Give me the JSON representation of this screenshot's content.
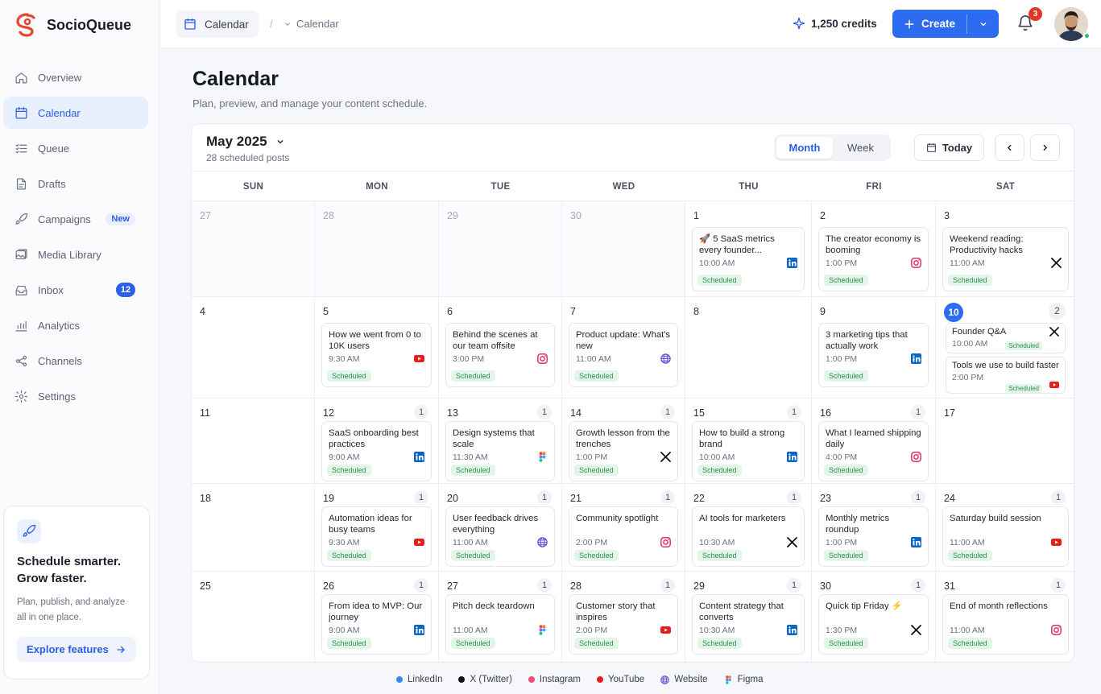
{
  "brand": {
    "name": "SocioQueue"
  },
  "nav": [
    {
      "key": "overview",
      "label": "Overview",
      "icon": "home-icon"
    },
    {
      "key": "calendar",
      "label": "Calendar",
      "icon": "calendar-icon",
      "active": true
    },
    {
      "key": "queue",
      "label": "Queue",
      "icon": "list-check-icon"
    },
    {
      "key": "drafts",
      "label": "Drafts",
      "icon": "file-icon"
    },
    {
      "key": "campaigns",
      "label": "Campaigns",
      "icon": "rocket-icon",
      "badge": "New"
    },
    {
      "key": "media-library",
      "label": "Media Library",
      "icon": "image-icon"
    },
    {
      "key": "inbox",
      "label": "Inbox",
      "icon": "inbox-icon",
      "count": "12"
    },
    {
      "key": "analytics",
      "label": "Analytics",
      "icon": "bar-chart-icon"
    },
    {
      "key": "channels",
      "label": "Channels",
      "icon": "share-icon"
    },
    {
      "key": "settings",
      "label": "Settings",
      "icon": "gear-icon"
    }
  ],
  "promo": {
    "title_line1": "Schedule smarter.",
    "title_line2": "Grow faster.",
    "text_line1": "Plan, publish, and analyze",
    "text_line2": "all in one place.",
    "button": "Explore features"
  },
  "topbar": {
    "crumb_main": "Calendar",
    "crumb_sep": "/",
    "crumb_sub": "Calendar",
    "credits": "1,250 credits",
    "create": "Create",
    "notifications": "3"
  },
  "page": {
    "title": "Calendar",
    "subtitle": "Plan, preview, and manage your content schedule."
  },
  "calendar": {
    "month": "May 2025",
    "post_count": "28 scheduled posts",
    "views": [
      "Month",
      "Week"
    ],
    "active_view": "Month",
    "today_label": "Today",
    "days_of_week": [
      "SUN",
      "MON",
      "TUE",
      "WED",
      "THU",
      "FRI",
      "SAT"
    ],
    "weeks": [
      [
        {
          "day": "27",
          "muted": true
        },
        {
          "day": "28",
          "muted": true
        },
        {
          "day": "29",
          "muted": true
        },
        {
          "day": "30",
          "muted": true
        },
        {
          "day": "1",
          "posts": [
            {
              "title": "🚀 5 SaaS metrics every founder...",
              "time": "10:00 AM",
              "channel": "linkedin",
              "status": "Scheduled"
            }
          ]
        },
        {
          "day": "2",
          "posts": [
            {
              "title": "The creator economy is booming",
              "time": "1:00 PM",
              "channel": "instagram",
              "status": "Scheduled"
            }
          ]
        },
        {
          "day": "3",
          "posts": [
            {
              "title": "Weekend reading: Productivity hacks",
              "time": "11:00 AM",
              "channel": "x",
              "status": "Scheduled"
            }
          ]
        }
      ],
      [
        {
          "day": "4"
        },
        {
          "day": "5",
          "posts": [
            {
              "title": "How we went from 0 to 10K users",
              "time": "9:30 AM",
              "channel": "youtube",
              "status": "Scheduled"
            }
          ]
        },
        {
          "day": "6",
          "posts": [
            {
              "title": "Behind the scenes at our team offsite",
              "time": "3:00 PM",
              "channel": "instagram",
              "status": "Scheduled"
            }
          ]
        },
        {
          "day": "7",
          "posts": [
            {
              "title": "Product update: What's new",
              "time": "11:00 AM",
              "channel": "website",
              "status": "Scheduled"
            }
          ]
        },
        {
          "day": "8"
        },
        {
          "day": "9",
          "posts": [
            {
              "title": "3 marketing tips that actually work",
              "time": "1:00 PM",
              "channel": "linkedin",
              "status": "Scheduled"
            }
          ]
        },
        {
          "day": "10",
          "today": true,
          "count": "2",
          "posts": [
            {
              "title": "Founder Q&A",
              "time": "10:00 AM",
              "channel": "x",
              "status": "Scheduled"
            },
            {
              "title": "Tools we use to build faster",
              "time": "2:00 PM",
              "channel": "youtube",
              "status": "Scheduled"
            }
          ]
        }
      ],
      [
        {
          "day": "11"
        },
        {
          "day": "12",
          "count": "1",
          "posts": [
            {
              "title": "SaaS onboarding best practices",
              "time": "9:00 AM",
              "channel": "linkedin",
              "status": "Scheduled"
            }
          ]
        },
        {
          "day": "13",
          "count": "1",
          "posts": [
            {
              "title": "Design systems that scale",
              "time": "11:30 AM",
              "channel": "figma",
              "status": "Scheduled"
            }
          ]
        },
        {
          "day": "14",
          "count": "1",
          "posts": [
            {
              "title": "Growth lesson from the trenches",
              "time": "1:00 PM",
              "channel": "x",
              "status": "Scheduled"
            }
          ]
        },
        {
          "day": "15",
          "count": "1",
          "posts": [
            {
              "title": "How to build a strong brand",
              "time": "10:00 AM",
              "channel": "linkedin",
              "status": "Scheduled"
            }
          ]
        },
        {
          "day": "16",
          "count": "1",
          "posts": [
            {
              "title": "What I learned shipping daily",
              "time": "4:00 PM",
              "channel": "instagram",
              "status": "Scheduled"
            }
          ]
        },
        {
          "day": "17"
        }
      ],
      [
        {
          "day": "18"
        },
        {
          "day": "19",
          "count": "1",
          "posts": [
            {
              "title": "Automation ideas for busy teams",
              "time": "9:30 AM",
              "channel": "youtube",
              "status": "Scheduled"
            }
          ]
        },
        {
          "day": "20",
          "count": "1",
          "posts": [
            {
              "title": "User feedback drives everything",
              "time": "11:00 AM",
              "channel": "website",
              "status": "Scheduled"
            }
          ]
        },
        {
          "day": "21",
          "count": "1",
          "posts": [
            {
              "title": "Community spotlight",
              "time": "2:00 PM",
              "channel": "instagram",
              "status": "Scheduled"
            }
          ]
        },
        {
          "day": "22",
          "count": "1",
          "posts": [
            {
              "title": "AI tools for marketers",
              "time": "10:30 AM",
              "channel": "x",
              "status": "Scheduled"
            }
          ]
        },
        {
          "day": "23",
          "count": "1",
          "posts": [
            {
              "title": "Monthly metrics roundup",
              "time": "1:00 PM",
              "channel": "linkedin",
              "status": "Scheduled"
            }
          ]
        },
        {
          "day": "24",
          "count": "1",
          "posts": [
            {
              "title": "Saturday build session",
              "time": "11:00 AM",
              "channel": "youtube",
              "status": "Scheduled"
            }
          ]
        }
      ],
      [
        {
          "day": "25"
        },
        {
          "day": "26",
          "count": "1",
          "posts": [
            {
              "title": "From idea to MVP: Our journey",
              "time": "9:00 AM",
              "channel": "linkedin",
              "status": "Scheduled"
            }
          ]
        },
        {
          "day": "27",
          "count": "1",
          "posts": [
            {
              "title": "Pitch deck teardown",
              "time": "11:00 AM",
              "channel": "figma",
              "status": "Scheduled"
            }
          ]
        },
        {
          "day": "28",
          "count": "1",
          "posts": [
            {
              "title": "Customer story that inspires",
              "time": "2:00 PM",
              "channel": "youtube",
              "status": "Scheduled"
            }
          ]
        },
        {
          "day": "29",
          "count": "1",
          "posts": [
            {
              "title": "Content strategy that converts",
              "time": "10:30 AM",
              "channel": "linkedin",
              "status": "Scheduled"
            }
          ]
        },
        {
          "day": "30",
          "count": "1",
          "posts": [
            {
              "title": "Quick tip Friday ⚡",
              "time": "1:30 PM",
              "channel": "x",
              "status": "Scheduled"
            }
          ]
        },
        {
          "day": "31",
          "count": "1",
          "posts": [
            {
              "title": "End of month reflections",
              "time": "11:00 AM",
              "channel": "instagram",
              "status": "Scheduled"
            }
          ]
        }
      ]
    ]
  },
  "legend": [
    {
      "key": "linkedin",
      "label": "LinkedIn",
      "color": "#2d8cf0"
    },
    {
      "key": "x",
      "label": "X (Twitter)",
      "color": "#111111"
    },
    {
      "key": "instagram",
      "label": "Instagram",
      "color": "#ec4f7a"
    },
    {
      "key": "youtube",
      "label": "YouTube",
      "color": "#e0211c"
    },
    {
      "key": "website",
      "label": "Website",
      "color": "#6b4fd6"
    },
    {
      "key": "figma",
      "label": "Figma",
      "color": "#f24e1e"
    }
  ],
  "colors": {
    "accent": "#2d6bf0",
    "scheduled_text": "#2f8f4e",
    "scheduled_bg": "#e3f5e8",
    "notification": "#e5352b"
  }
}
